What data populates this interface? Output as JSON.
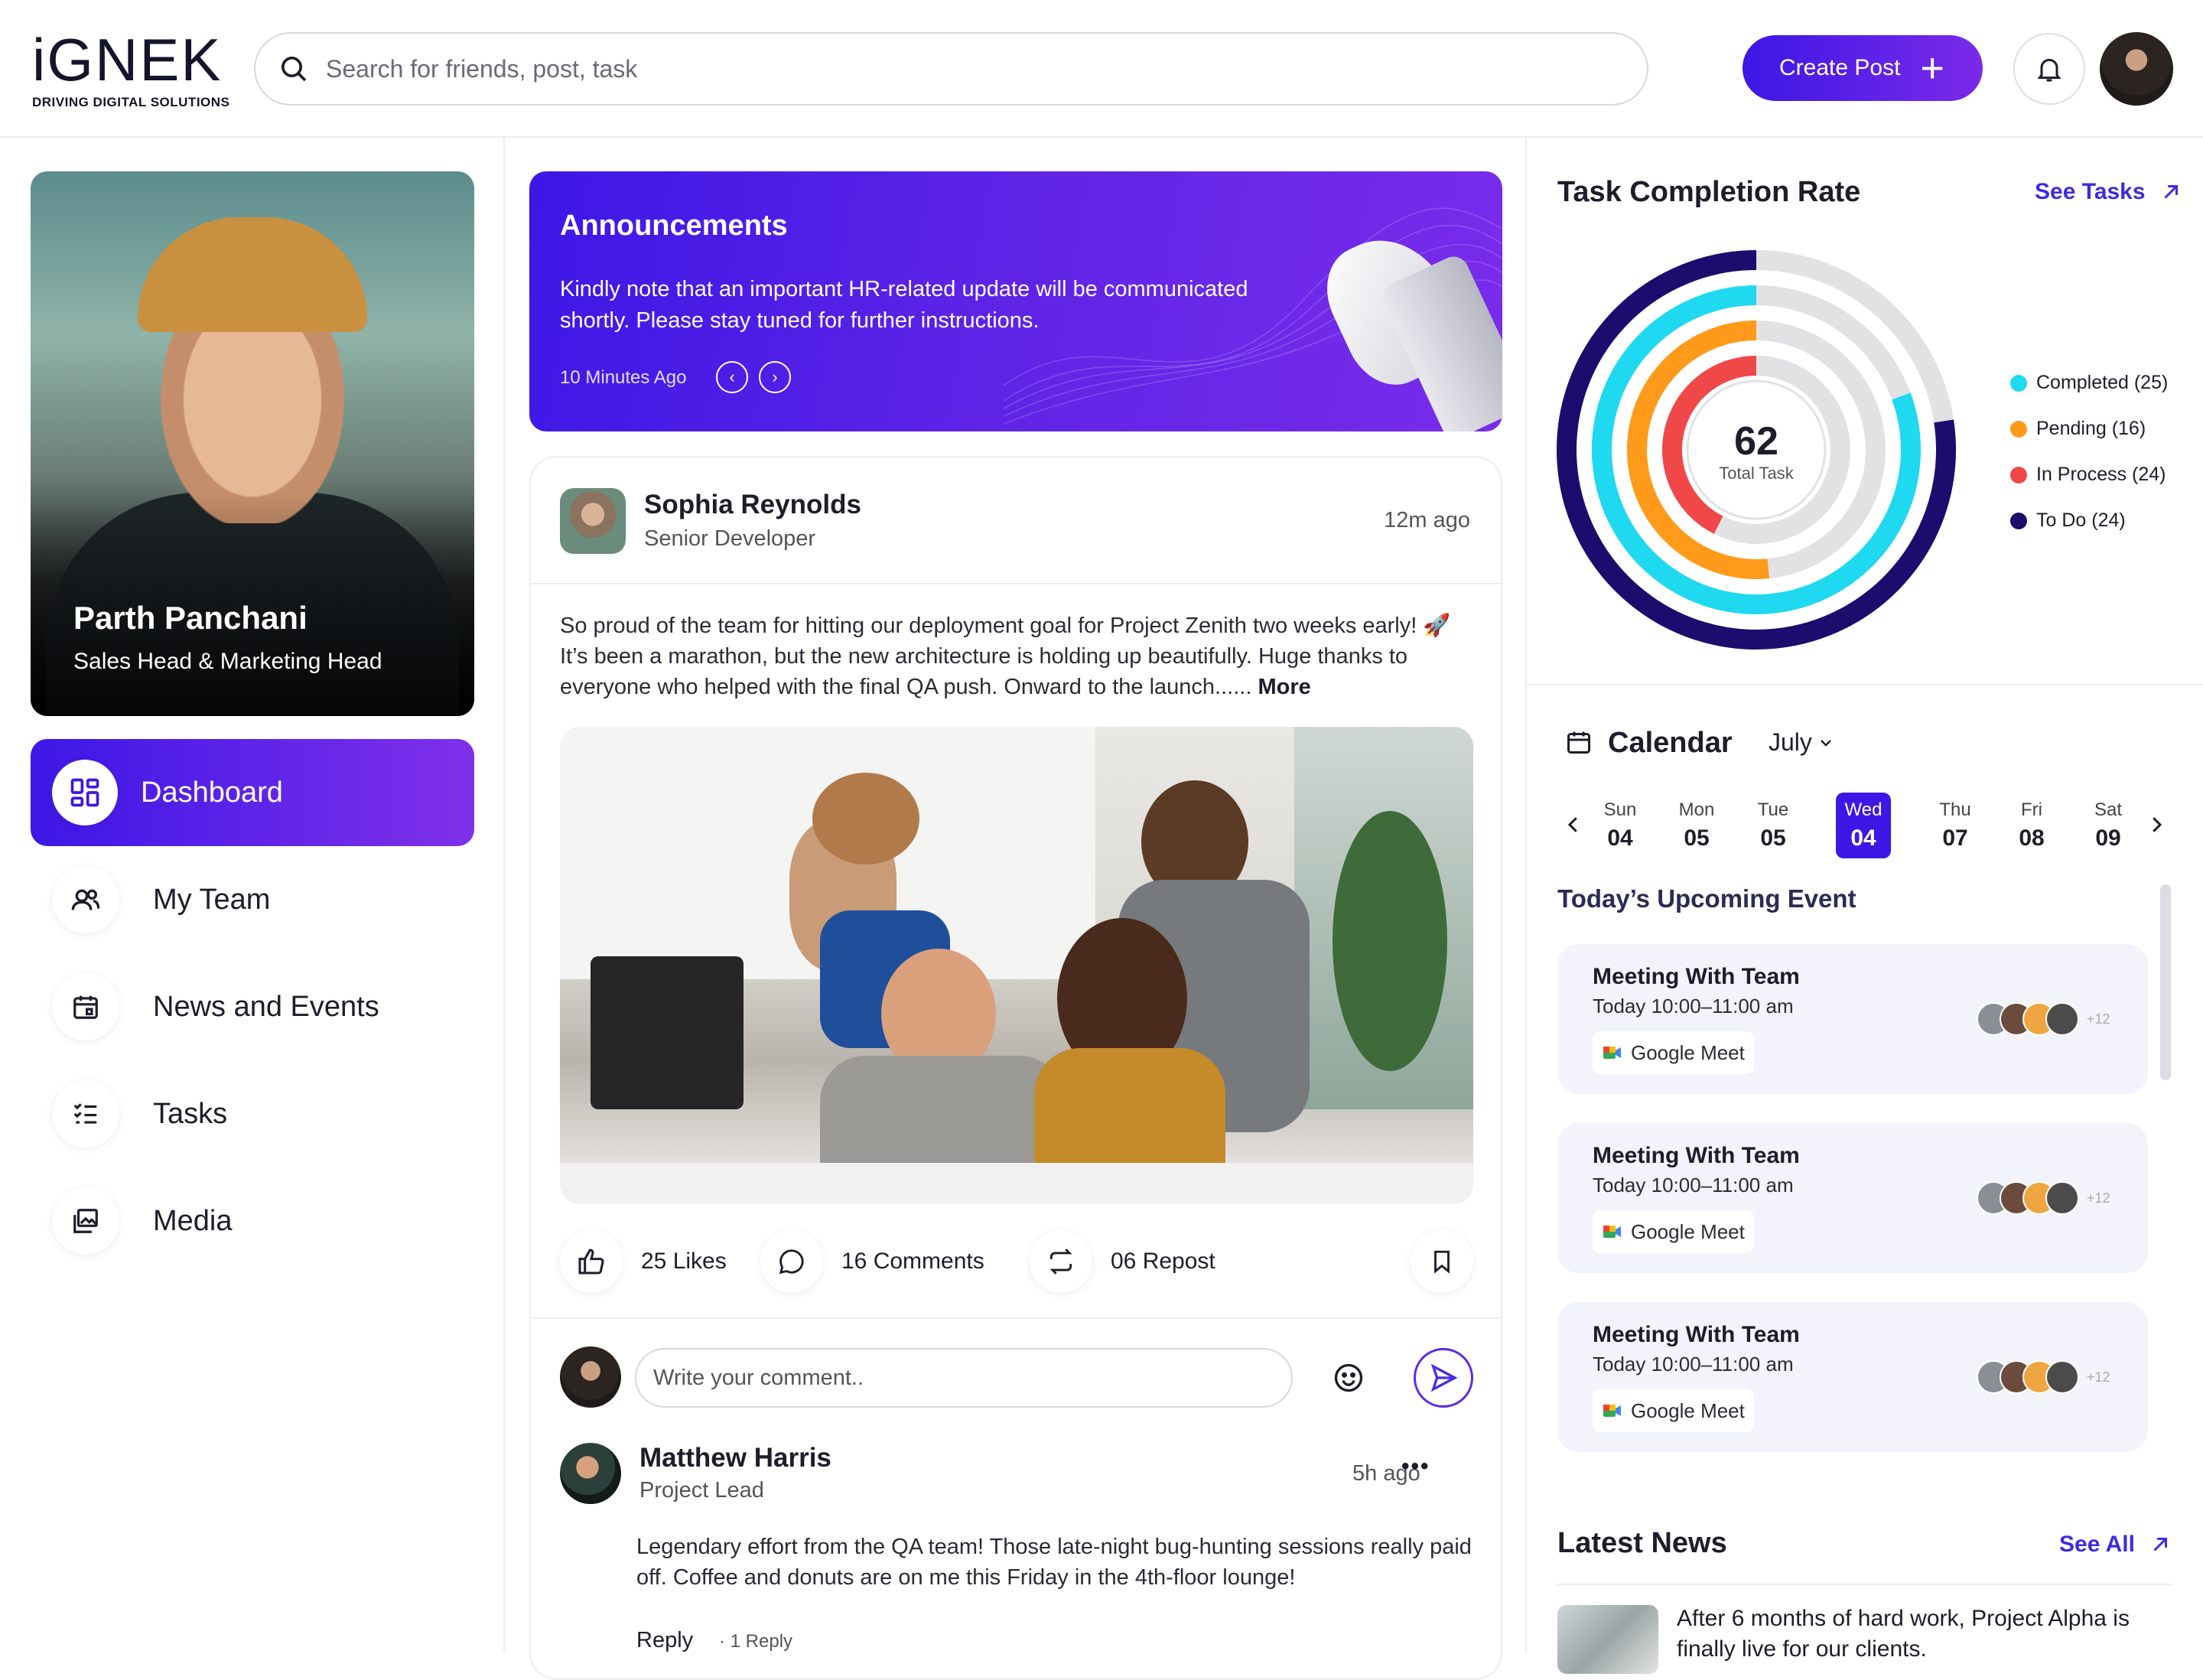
{
  "header": {
    "logo_word": "iGNEK",
    "logo_tagline": "DRIVING DIGITAL SOLUTIONS",
    "search_placeholder": "Search for friends, post, task",
    "create_post_label": "Create Post"
  },
  "profile": {
    "name": "Parth Panchani",
    "role": "Sales Head & Marketing Head"
  },
  "nav": {
    "items": [
      {
        "label": "Dashboard",
        "icon": "dashboard-icon",
        "active": true
      },
      {
        "label": "My Team",
        "icon": "team-icon"
      },
      {
        "label": "News and Events",
        "icon": "calendar-icon"
      },
      {
        "label": "Tasks",
        "icon": "tasks-icon"
      },
      {
        "label": "Media",
        "icon": "media-icon"
      }
    ]
  },
  "announcement": {
    "title": "Announcements",
    "body": "Kindly note that an important HR-related update will be communicated shortly. Please stay tuned for further instructions.",
    "time": "10 Minutes Ago"
  },
  "post": {
    "author": "Sophia Reynolds",
    "role": "Senior Developer",
    "time": "12m ago",
    "text": "So proud of the team for hitting our deployment goal for Project Zenith two weeks early! 🚀 It’s been a marathon, but the new architecture is holding up beautifully. Huge thanks to everyone who helped with the final QA push. Onward to the launch......",
    "more_label": "More",
    "likes": "25 Likes",
    "comments": "16 Comments",
    "reposts": "06 Repost",
    "comment_placeholder": "Write your comment.."
  },
  "reply": {
    "author": "Matthew Harris",
    "role": "Project Lead",
    "time": "5h ago",
    "more": "•••",
    "text": "Legendary effort from the QA team! Those late-night bug-hunting sessions really paid off. Coffee and donuts are on me this Friday in the 4th-floor lounge!",
    "reply_label": "Reply",
    "reply_count": "· 1 Reply"
  },
  "task_completion": {
    "title": "Task Completion Rate",
    "see_label": "See Tasks",
    "total": "62",
    "total_label": "Total Task",
    "legend": [
      {
        "label": "Completed (25)",
        "color": "#1ed9ef"
      },
      {
        "label": "Pending (16)",
        "color": "#ff9a1a"
      },
      {
        "label": "In Process (24)",
        "color": "#f04848"
      },
      {
        "label": "To Do (24)",
        "color": "#1c0c6e"
      }
    ]
  },
  "calendar": {
    "title": "Calendar",
    "month": "July",
    "days": [
      {
        "name": "Sun",
        "date": "04"
      },
      {
        "name": "Mon",
        "date": "05"
      },
      {
        "name": "Tue",
        "date": "05"
      },
      {
        "name": "Wed",
        "date": "04",
        "selected": true
      },
      {
        "name": "Thu",
        "date": "07"
      },
      {
        "name": "Fri",
        "date": "08"
      },
      {
        "name": "Sat",
        "date": "09"
      }
    ],
    "upcoming_title": "Today’s Upcoming Event",
    "events": [
      {
        "title": "Meeting With Team",
        "time": "Today 10:00–11:00 am",
        "platform": "Google Meet",
        "more": "+12"
      },
      {
        "title": "Meeting With Team",
        "time": "Today 10:00–11:00 am",
        "platform": "Google Meet",
        "more": "+12"
      },
      {
        "title": "Meeting With Team",
        "time": "Today 10:00–11:00 am",
        "platform": "Google Meet",
        "more": "+12"
      }
    ]
  },
  "news": {
    "title": "Latest News",
    "see_label": "See All",
    "item_text": "After 6 months of hard work, Project Alpha is finally live for our clients."
  },
  "colors": {
    "accent": "#3d17e6",
    "accent_end": "#7b2ae8",
    "link": "#3d2be0"
  }
}
